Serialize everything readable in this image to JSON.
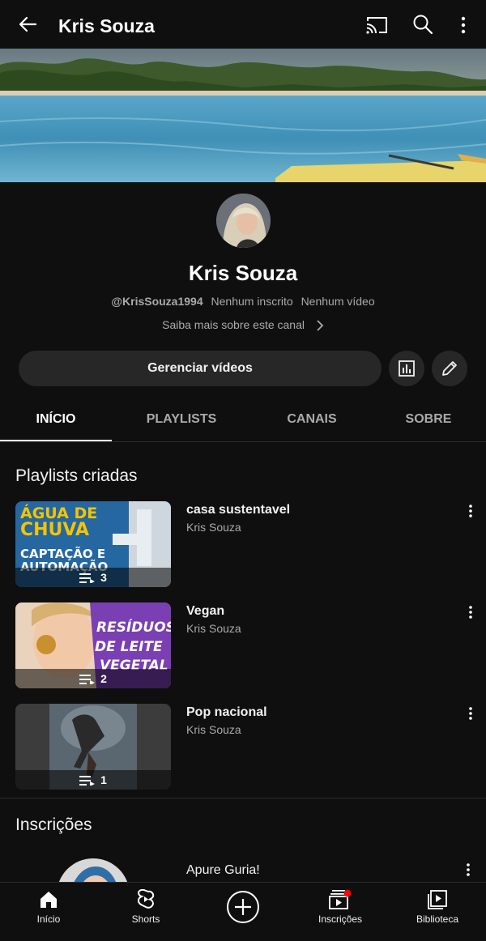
{
  "header": {
    "title": "Kris Souza",
    "icons": [
      "back-arrow-icon",
      "cast-icon",
      "search-icon",
      "more-vertical-icon"
    ]
  },
  "channel": {
    "name": "Kris Souza",
    "handle": "@KrisSouza1994",
    "subscribers": "Nenhum inscrito",
    "videos": "Nenhum vídeo",
    "about_link": "Saiba mais sobre este canal"
  },
  "actions": {
    "manage_label": "Gerenciar vídeos",
    "analytics_icon": "analytics-icon",
    "edit_icon": "pencil-icon"
  },
  "tabs": [
    {
      "label": "INÍCIO",
      "active": true
    },
    {
      "label": "PLAYLISTS",
      "active": false
    },
    {
      "label": "CANAIS",
      "active": false
    },
    {
      "label": "SOBRE",
      "active": false
    }
  ],
  "playlists_section": {
    "title": "Playlists criadas",
    "items": [
      {
        "title": "casa sustentavel",
        "owner": "Kris Souza",
        "count": "3",
        "thumb_text_1": "ÁGUA DE",
        "thumb_text_2": "CHUVA",
        "thumb_text_3": "CAPTAÇÃO E",
        "thumb_text_4": "AUTOMAÇÃO"
      },
      {
        "title": "Vegan",
        "owner": "Kris Souza",
        "count": "2",
        "thumb_text_1": "RESÍDUOS",
        "thumb_text_2": "DE LEITE",
        "thumb_text_3": "VEGETAL"
      },
      {
        "title": "Pop nacional",
        "owner": "Kris Souza",
        "count": "1"
      }
    ]
  },
  "subscriptions_section": {
    "title": "Inscrições",
    "items": [
      {
        "name": "Apure Guria!"
      }
    ]
  },
  "bottom_nav": [
    {
      "label": "Início",
      "icon": "home-icon",
      "active": true
    },
    {
      "label": "Shorts",
      "icon": "shorts-icon",
      "active": false
    },
    {
      "label": "",
      "icon": "create-plus-icon",
      "active": false
    },
    {
      "label": "Inscrições",
      "icon": "subscriptions-icon",
      "active": false,
      "badge": true
    },
    {
      "label": "Biblioteca",
      "icon": "library-icon",
      "active": false
    }
  ],
  "colors": {
    "background": "#0f0f0f",
    "surface": "#272727",
    "text_primary": "#f1f1f1",
    "text_secondary": "#aaaaaa",
    "badge": "#ff0000"
  }
}
